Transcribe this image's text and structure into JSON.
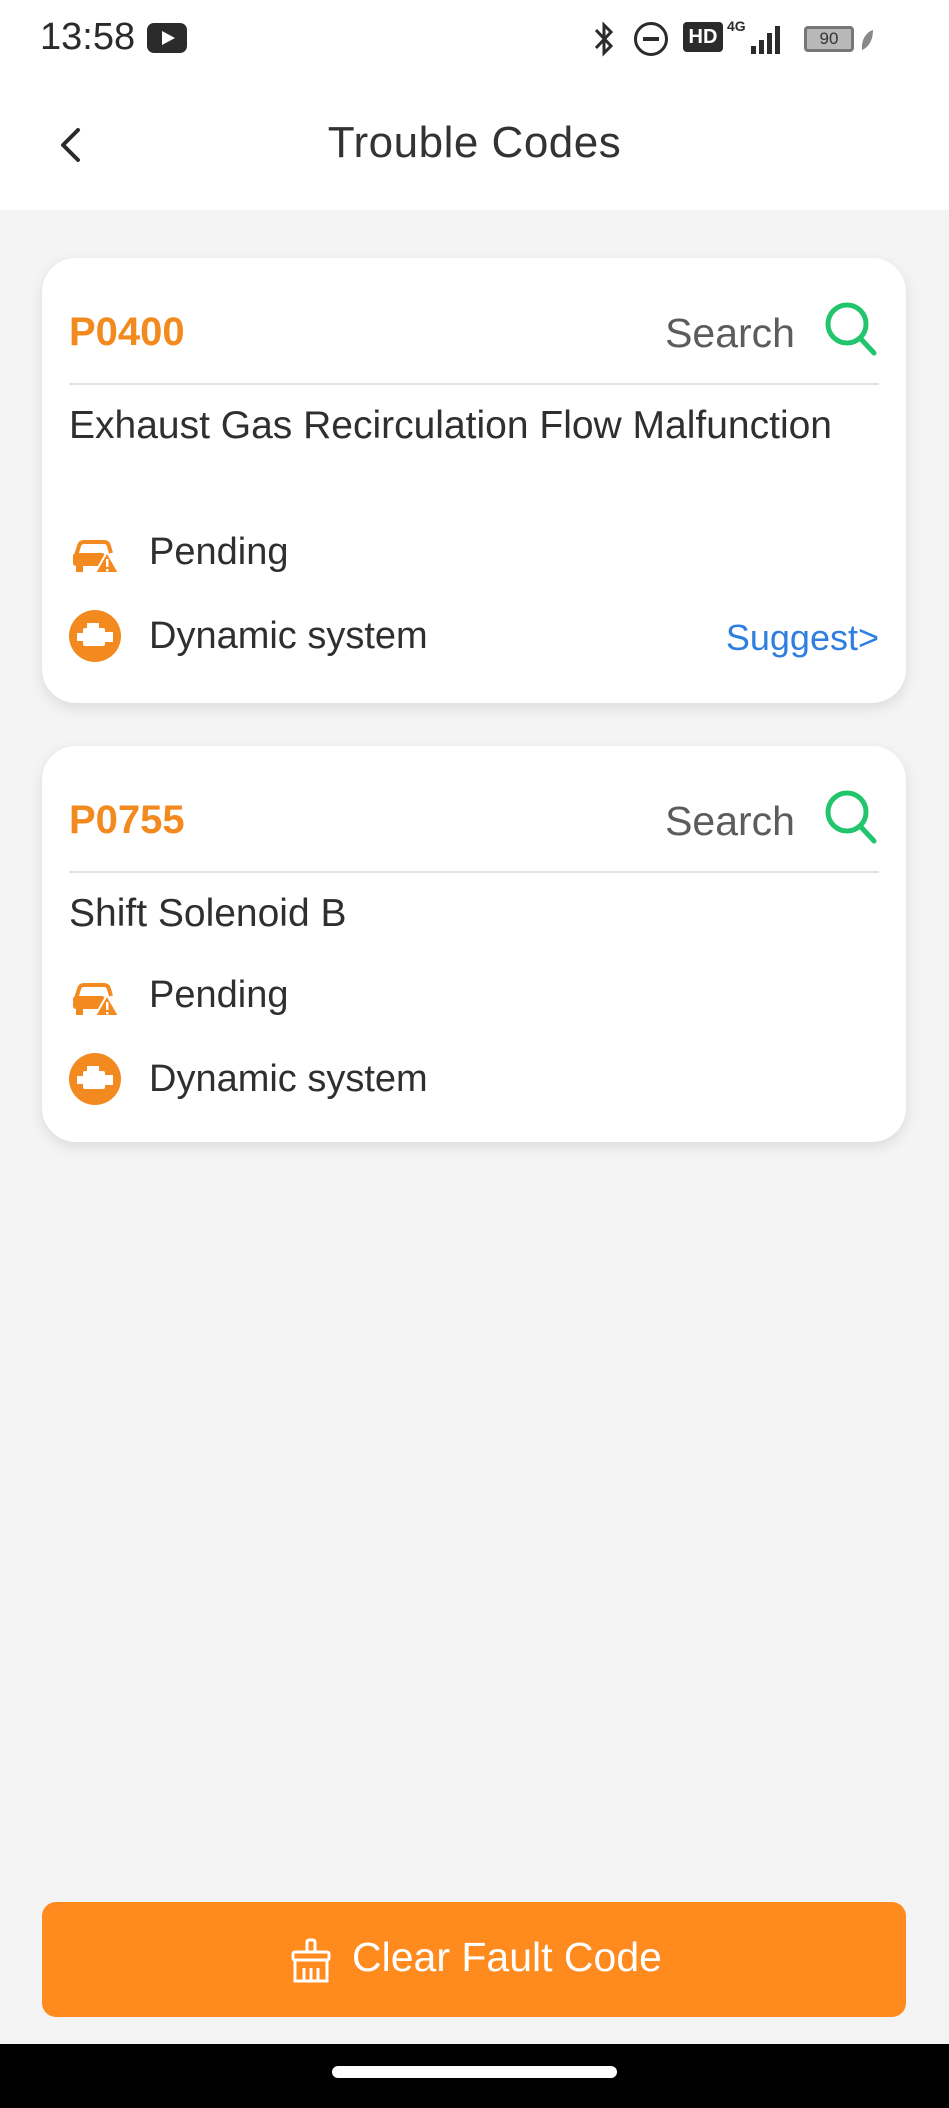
{
  "status_bar": {
    "time": "13:58",
    "hd_label": "HD",
    "network": "4G",
    "battery": "90"
  },
  "header": {
    "title": "Trouble Codes"
  },
  "codes": [
    {
      "code": "P0400",
      "search_label": "Search",
      "description": "Exhaust Gas Recirculation Flow Malfunction",
      "status": "Pending",
      "system": "Dynamic system",
      "suggest_label": "Suggest>"
    },
    {
      "code": "P0755",
      "search_label": "Search",
      "description": "Shift Solenoid B",
      "status": "Pending",
      "system": "Dynamic system"
    }
  ],
  "footer": {
    "clear_label": "Clear Fault Code"
  },
  "icons": {
    "back": "chevron-left-icon",
    "search": "search-icon",
    "status": "car-warning-icon",
    "system": "engine-icon",
    "clear": "broom-icon"
  },
  "colors": {
    "accent": "#f28a1f",
    "button": "#ff8a1e",
    "search": "#22c56b",
    "link": "#2f7fe0"
  }
}
